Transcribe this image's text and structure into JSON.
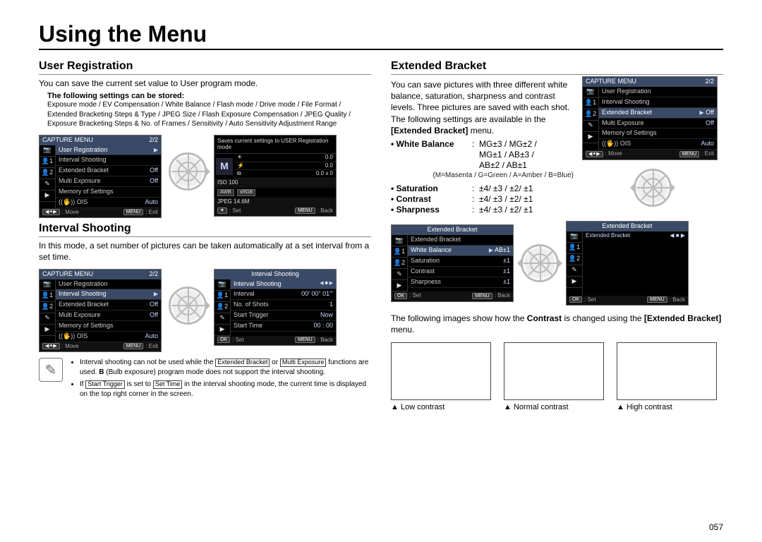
{
  "page": {
    "title": "Using the Menu",
    "number": "057"
  },
  "left": {
    "ur": {
      "heading": "User Registration",
      "lead": "You can save the current set value to User program mode.",
      "stored_head": "The following settings can be stored:",
      "stored_body": "Exposure mode / EV Compensation / White Balance / Flash mode / Drive mode / File Format / Extended Bracketing Steps & Type / JPEG Size / Flash Exposure Compensation / JPEG Quality / Exposure Bracketing Steps & No. of Frames / Sensitivity / Auto Sensitivity Adjustment Range"
    },
    "is": {
      "heading": "Interval Shooting",
      "lead": "In this mode, a set number of pictures can be taken automatically at a set interval from a set time."
    },
    "notes": {
      "n1a": "Interval shooting can not be used while the ",
      "n1b": "Extended Bracket",
      "n1c": " or ",
      "n1d": "Multi Exposure",
      "n1e": " functions are used. ",
      "n1f": "B",
      "n1g": " (Bulb exposure) program mode does not support the interval shooting.",
      "n2a": "If ",
      "n2b": "Start Trigger",
      "n2c": " is set to ",
      "n2d": "Set Time",
      "n2e": " in the interval shooting mode, the current time is displayed on the top right corner in the screen."
    }
  },
  "right": {
    "eb": {
      "heading": "Extended Bracket",
      "p1": "You can save pictures with three different white balance, saturation, sharpness and contrast levels. Three pictures are saved with each shot. The following settings are available in the ",
      "p1b": "[Extended Bracket]",
      "p1c": " menu.",
      "params": {
        "wb_label": "White Balance",
        "wb_val1": "MG±3 / MG±2 /",
        "wb_val2": "MG±1 / AB±3 /",
        "wb_val3": "AB±2 / AB±1",
        "wb_note": "(M=Masenta / G=Green / A=Amber / B=Blue)",
        "sat_label": "Saturation",
        "sat_val": "±4/ ±3 / ±2/ ±1",
        "con_label": "Contrast",
        "con_val": "±4/ ±3 / ±2/ ±1",
        "sha_label": "Sharpness",
        "sha_val": "±4/ ±3 / ±2/ ±1"
      },
      "p2a": "The following images show how the ",
      "p2b": "Contrast",
      "p2c": " is changed using the ",
      "p2d": "[Extended Bracket]",
      "p2e": " menu.",
      "caps": {
        "c1": "Low contrast",
        "c2": "Normal contrast",
        "c3": "High contrast"
      }
    }
  },
  "menu_common": {
    "capture_title": "CAPTURE MENU",
    "page_ind": "2/2",
    "move": "Move",
    "exit": "Exit",
    "set": "Set",
    "back": "Back",
    "menu_btn": "MENU",
    "ok_btn": "OK",
    "nav_btn": "◀✦▶",
    "items": {
      "ur": "User Registration",
      "is": "Interval Shooting",
      "eb": "Extended Bracket",
      "me": "Multi Exposure",
      "mos": "Memory of Settings",
      "ois": "((🖐)) OIS"
    },
    "vals": {
      "off": "Off",
      "auto": "Auto"
    },
    "tabs": {
      "cam": "📷",
      "p1": "👤1",
      "p2": "👤2",
      "tool": "✎",
      "play": "▶"
    }
  },
  "infobox": {
    "caption": "Saves current settings to USER Registration mode",
    "mode": "M",
    "ev": "0.0",
    "flash": "0.0",
    "bracket": "0.0 x 0",
    "iso": "ISO  100",
    "awb": "AWB",
    "srgb": "sRGB",
    "jpeg": "JPEG 14.6M"
  },
  "is_menu": {
    "title": "Interval Shooting",
    "row_is": "Interval Shooting",
    "row_interval": "Interval",
    "row_interval_v": "00' 00\" 01'\"",
    "row_shots": "No. of Shots",
    "row_shots_v": "1",
    "row_trigger": "Start Trigger",
    "row_trigger_v": "Now",
    "row_time": "Start Time",
    "row_time_v": "00 : 00"
  },
  "eb_menu": {
    "title": "Extended Bracket",
    "rows": {
      "eb": "Extended Bracket",
      "wb": "White Balance",
      "wb_v": "AB±1",
      "sat": "Saturation",
      "sat_v": "±1",
      "con": "Contrast",
      "con_v": "±1",
      "sha": "Sharpness",
      "sha_v": "±1"
    }
  }
}
